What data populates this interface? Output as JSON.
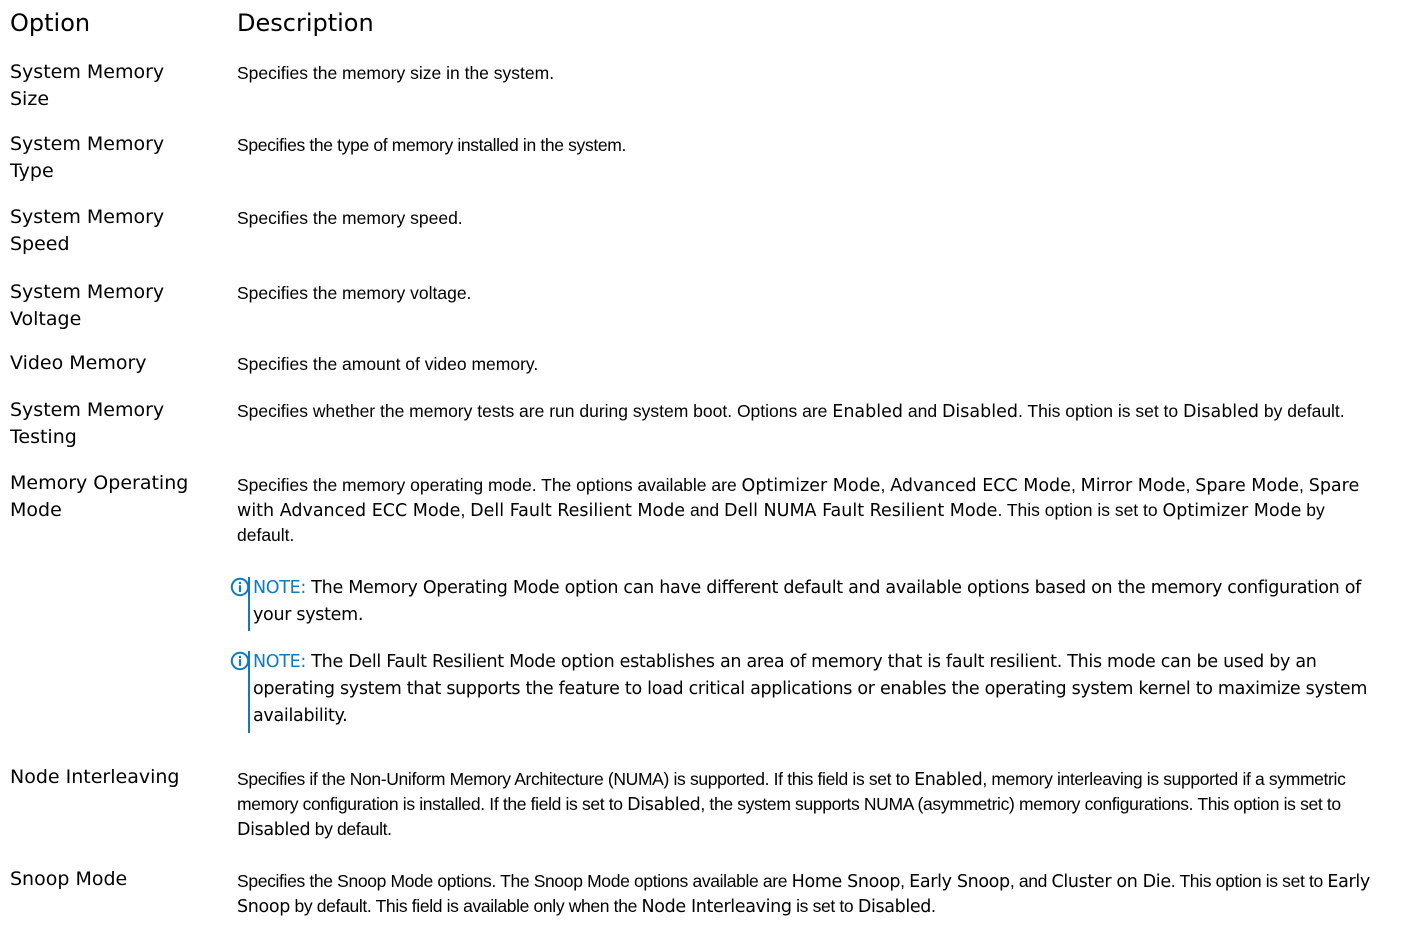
{
  "header": {
    "option": "Option",
    "description": "Description"
  },
  "rows": [
    {
      "option_line1": "System Memory",
      "option_line2": "Size",
      "description": "Specifies the memory size in the system."
    },
    {
      "option_line1": "System Memory",
      "option_line2": "Type",
      "description": "Specifies the type of memory installed in the system."
    },
    {
      "option_line1": "System Memory",
      "option_line2": "Speed",
      "description": "Specifies the memory speed."
    },
    {
      "option_line1": "System Memory",
      "option_line2": "Voltage",
      "description": "Specifies the memory voltage."
    },
    {
      "option_line1": "Video Memory",
      "description": "Specifies the amount of video memory."
    },
    {
      "option_line1": "System Memory",
      "option_line2": "Testing",
      "description_parts": [
        "Specifies whether the memory tests are run during system boot. Options are ",
        "Enabled",
        " and ",
        "Disabled",
        ". This option is set to ",
        "Disabled",
        " by default."
      ]
    },
    {
      "option_line1": "Memory Operating",
      "option_line2": "Mode",
      "description_parts": [
        "Specifies the memory operating mode. The options available are ",
        "Optimizer Mode",
        ", ",
        "Advanced ECC Mode",
        ", ",
        "Mirror Mode",
        ", ",
        "Spare Mode",
        ", ",
        "Spare with Advanced ECC Mode",
        ", ",
        "Dell Fault Resilient Mode",
        " and ",
        "Dell NUMA Fault Resilient Mode",
        ". This option is set to ",
        "Optimizer Mode",
        " by default."
      ],
      "notes": [
        {
          "label": "NOTE:",
          "text": " The Memory Operating Mode option can have different default and available options based on the memory configuration of your system."
        },
        {
          "label": "NOTE:",
          "text": " The Dell Fault Resilient Mode option establishes an area of memory that is fault resilient. This mode can be used by an operating system that supports the feature to load critical applications or enables the operating system kernel to maximize system availability."
        }
      ]
    },
    {
      "option_line1": "Node Interleaving",
      "description_parts": [
        "Specifies if the Non-Uniform Memory Architecture (NUMA) is supported. If this field is set to ",
        "Enabled",
        ", memory interleaving is supported if a symmetric memory configuration is installed. If the field is set to ",
        "Disabled",
        ", the system supports NUMA (asymmetric) memory configurations. This option is set to ",
        "Disabled",
        " by default."
      ]
    },
    {
      "option_line1": "Snoop Mode",
      "description_parts": [
        "Specifies the Snoop Mode options. The Snoop Mode options available are ",
        "Home Snoop",
        ", ",
        "Early Snoop",
        ", and ",
        "Cluster on Die",
        ". This option is set to ",
        "Early Snoop",
        " by default. This field is available only when the ",
        "Node Interleaving",
        " is set to ",
        "Disabled",
        "."
      ]
    }
  ],
  "colors": {
    "note_accent": "#0d7bc0",
    "text": "#000000"
  },
  "icons": {
    "note": "info-icon"
  }
}
